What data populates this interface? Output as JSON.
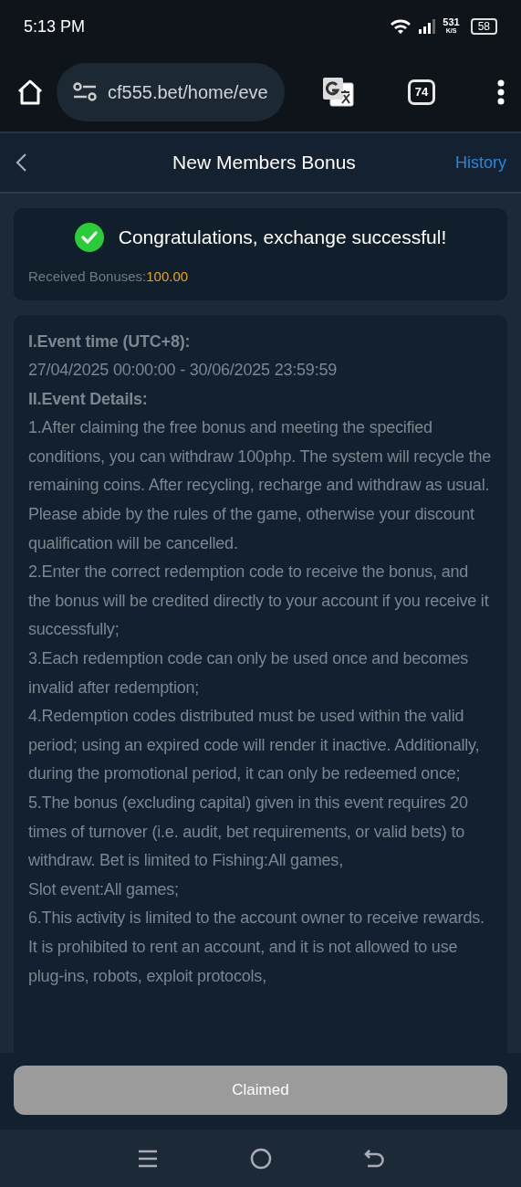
{
  "status_bar": {
    "time": "5:13 PM",
    "net_speed": "531",
    "net_unit": "K/S",
    "battery": "58"
  },
  "browser": {
    "url": "cf555.bet/home/eve",
    "tab_count": "74"
  },
  "header": {
    "title": "New Members Bonus",
    "action": "History"
  },
  "result": {
    "message": "Congratulations, exchange successful!",
    "label": "Received Bonuses:",
    "amount": "100.00"
  },
  "rules": [
    {
      "kind": "heading",
      "text": "I.Event time (UTC+8):"
    },
    {
      "kind": "text",
      "text": "27/04/2025 00:00:00 - 30/06/2025 23:59:59"
    },
    {
      "kind": "heading",
      "text": "II.Event Details:"
    },
    {
      "kind": "text",
      "text": "1.After claiming the free bonus and meeting the specified conditions, you can withdraw 100php. The system will recycle the remaining coins. After recycling, recharge and withdraw as usual. Please abide by the rules of the game, otherwise your discount qualification will be cancelled."
    },
    {
      "kind": "text",
      "text": "2.Enter the correct redemption code to receive the bonus, and the bonus will be credited directly to your account if you receive it successfully;"
    },
    {
      "kind": "text",
      "text": "3.Each redemption code can only be used once and becomes invalid after redemption;"
    },
    {
      "kind": "text",
      "text": "4.Redemption codes distributed must be used within the valid period; using an expired code will render it inactive. Additionally, during the promotional period, it can only be redeemed once;"
    },
    {
      "kind": "text",
      "text": "5.The bonus (excluding capital) given in this event requires 20 times of turnover (i.e. audit, bet requirements, or valid bets) to withdraw. Bet is limited to Fishing:All games,"
    },
    {
      "kind": "text",
      "text": "Slot event:All games;"
    },
    {
      "kind": "text",
      "text": "6.This activity is limited to the account owner to receive rewards. It is prohibited to rent an account, and it is not allowed to use plug-ins, robots, exploit protocols,"
    }
  ],
  "claim_button": {
    "label": "Claimed",
    "disabled": true
  }
}
